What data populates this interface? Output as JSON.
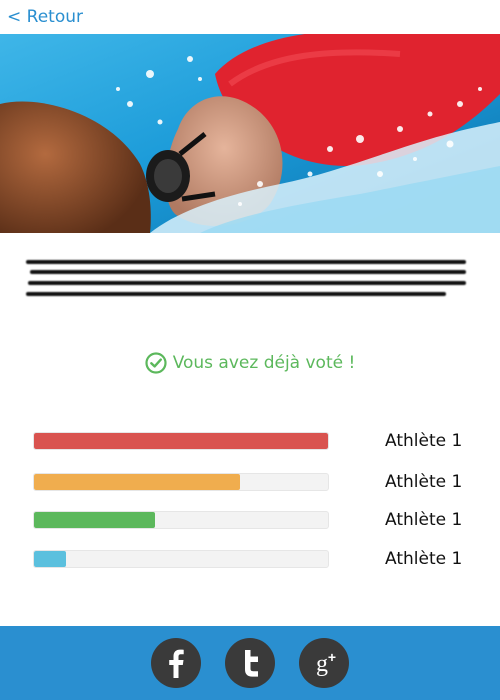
{
  "nav": {
    "back_label": "< Retour"
  },
  "hero": {
    "image": "swimmer-photo"
  },
  "status": {
    "voted_text": "Vous avez déjà voté !",
    "icon": "check-circle-icon"
  },
  "results": [
    {
      "label": "Athlète 1",
      "percent": 100,
      "color": "#d9534f"
    },
    {
      "label": "Athlète 1",
      "percent": 70,
      "color": "#f0ad4e"
    },
    {
      "label": "Athlète 1",
      "percent": 41,
      "color": "#5cb85c"
    },
    {
      "label": "Athlète 1",
      "percent": 11,
      "color": "#5bc0de"
    }
  ],
  "footer": {
    "background": "#2a8fd0",
    "icon_color": "#3a3a3a",
    "social": [
      {
        "name": "facebook-icon",
        "glyph": "f"
      },
      {
        "name": "twitter-icon",
        "glyph": "t"
      },
      {
        "name": "google-plus-icon",
        "glyph": "g+"
      }
    ]
  },
  "colors": {
    "accent": "#2a8fd0",
    "success": "#5cb85c"
  }
}
